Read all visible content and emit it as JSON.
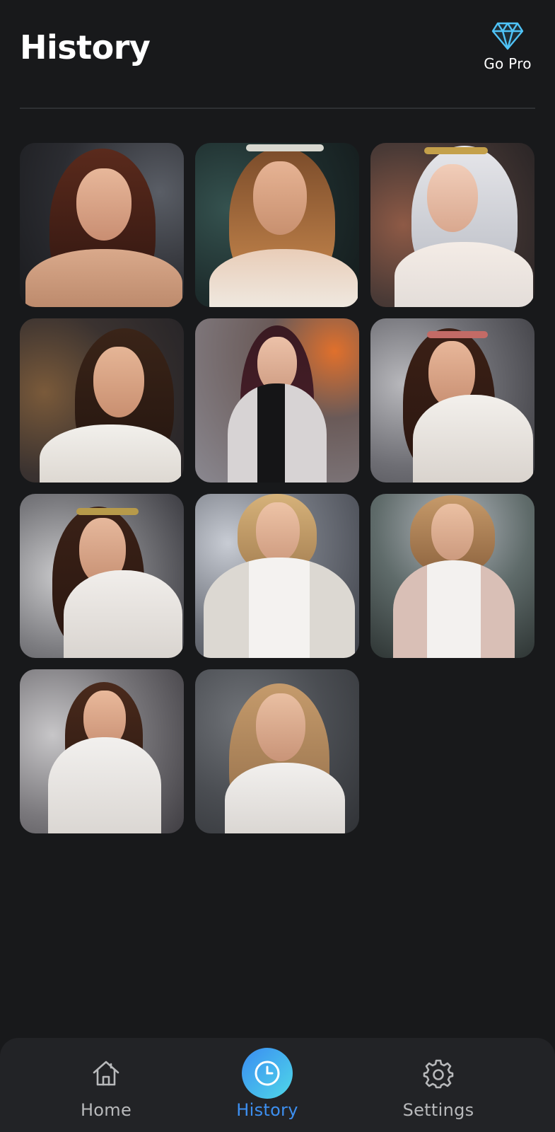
{
  "header": {
    "title": "History",
    "go_pro_label": "Go Pro"
  },
  "history": {
    "items": [
      {
        "desc": "woman with auburn hair, dark city street"
      },
      {
        "desc": "woman with tiara and lace dress, teal bokeh"
      },
      {
        "desc": "platinum-haired woman with golden crown"
      },
      {
        "desc": "brunette woman in white blazer, warm lights"
      },
      {
        "desc": "woman in grey blazer, street with orange lights"
      },
      {
        "desc": "woman with flower crown, white lace top"
      },
      {
        "desc": "woman with gold headband, white top"
      },
      {
        "desc": "blonde woman in white coat, city"
      },
      {
        "desc": "blonde woman in pink cardigan, foggy forest"
      },
      {
        "desc": "woman in white turtleneck sweater, street"
      },
      {
        "desc": "blonde woman in white knit, grey backdrop"
      }
    ]
  },
  "nav": {
    "items": [
      {
        "label": "Home",
        "icon": "home-icon",
        "active": false
      },
      {
        "label": "History",
        "icon": "clock-icon",
        "active": true
      },
      {
        "label": "Settings",
        "icon": "gear-icon",
        "active": false
      }
    ]
  },
  "colors": {
    "background": "#18191b",
    "nav_background": "#222326",
    "accent": "#3d8ff0",
    "diamond": "#4fc3f7"
  }
}
